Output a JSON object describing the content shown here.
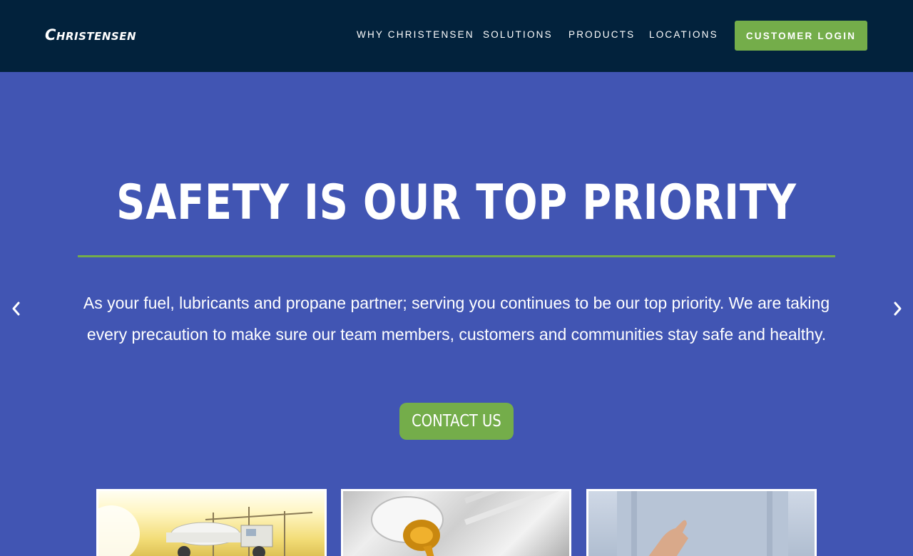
{
  "header": {
    "logo_text": "Christensen",
    "nav": [
      {
        "label": "WHY CHRISTENSEN"
      },
      {
        "label": "SOLUTIONS"
      },
      {
        "label": "PRODUCTS"
      },
      {
        "label": "LOCATIONS"
      }
    ],
    "login_label": "CUSTOMER LOGIN"
  },
  "hero": {
    "title": "SAFETY IS OUR TOP PRIORITY",
    "body": "As your fuel, lubricants and propane partner; serving you continues to be our top priority. We are taking every precaution to make sure our team members, customers and communities stay safe and healthy.",
    "cta_label": "CONTACT US"
  },
  "carousel": {
    "prev_icon": "chevron-left-icon",
    "next_icon": "chevron-right-icon"
  },
  "cards": [
    {
      "image": "propane-truck-photo"
    },
    {
      "image": "oil-pouring-photo"
    },
    {
      "image": "handshake-photo"
    }
  ],
  "colors": {
    "header_bg": "#02223c",
    "hero_bg": "#4155b3",
    "accent_green": "#74ad4a",
    "text": "#ffffff"
  }
}
